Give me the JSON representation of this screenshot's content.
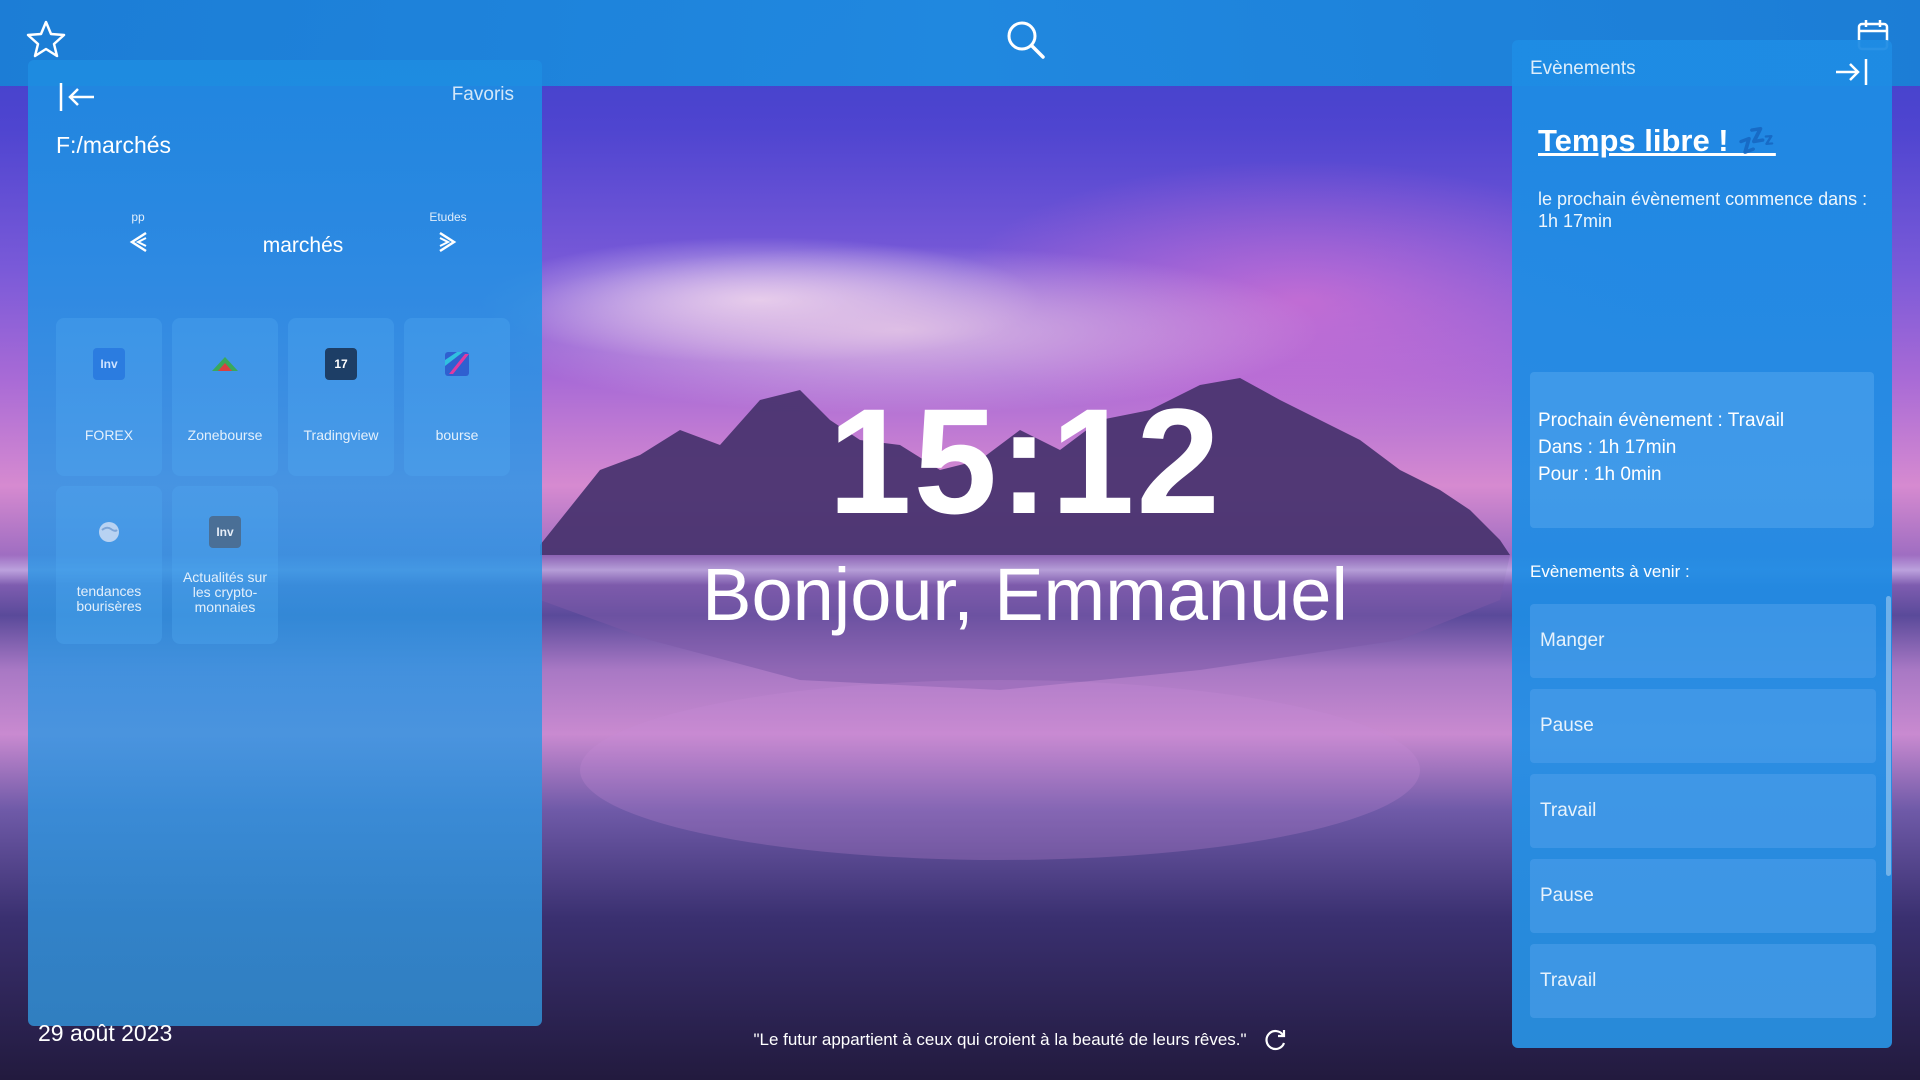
{
  "topbar": {
    "favorites_icon": "star-icon",
    "search_icon": "search-icon",
    "calendar_icon": "calendar-icon"
  },
  "left_panel": {
    "back_icon": "arrow-left-icon",
    "favoris_label": "Favoris",
    "path": "F:/marchés",
    "nav": {
      "prev_label": "pp",
      "current": "marchés",
      "next_label": "Etudes"
    },
    "tiles": [
      {
        "label": "FOREX",
        "icon": "investing-icon",
        "icon_text": "Inv"
      },
      {
        "label": "Zonebourse",
        "icon": "zonebourse-icon",
        "icon_text": ""
      },
      {
        "label": "Tradingview",
        "icon": "tradingview-icon",
        "icon_text": "17"
      },
      {
        "label": "bourse",
        "icon": "bourse-icon",
        "icon_text": ""
      },
      {
        "label": "tendances bourisères",
        "icon": "globe-icon",
        "icon_text": ""
      },
      {
        "label": "Actualités sur les crypto-monnaies",
        "icon": "investing-icon",
        "icon_text": "Inv"
      }
    ]
  },
  "center": {
    "time": "15:12",
    "greeting": "Bonjour, Emmanuel",
    "date": "29 août 2023",
    "quote": "\"Le futur appartient à ceux qui croient à la beauté de leurs rêves.\""
  },
  "right_panel": {
    "title": "Evènements",
    "free_title": "Temps libre ! 💤",
    "free_subtitle": "le prochain évènement commence dans : 1h 17min",
    "next_event": {
      "line1": "Prochain évènement : Travail",
      "line2": "Dans : 1h 17min",
      "line3": "Pour : 1h 0min"
    },
    "upcoming_title": "Evènements à venir :",
    "upcoming": [
      {
        "label": "Manger"
      },
      {
        "label": "Pause"
      },
      {
        "label": "Travail"
      },
      {
        "label": "Pause"
      },
      {
        "label": "Travail"
      }
    ]
  },
  "colors": {
    "topbar": "#1f8ae0",
    "panel": "#1e8ce1"
  }
}
